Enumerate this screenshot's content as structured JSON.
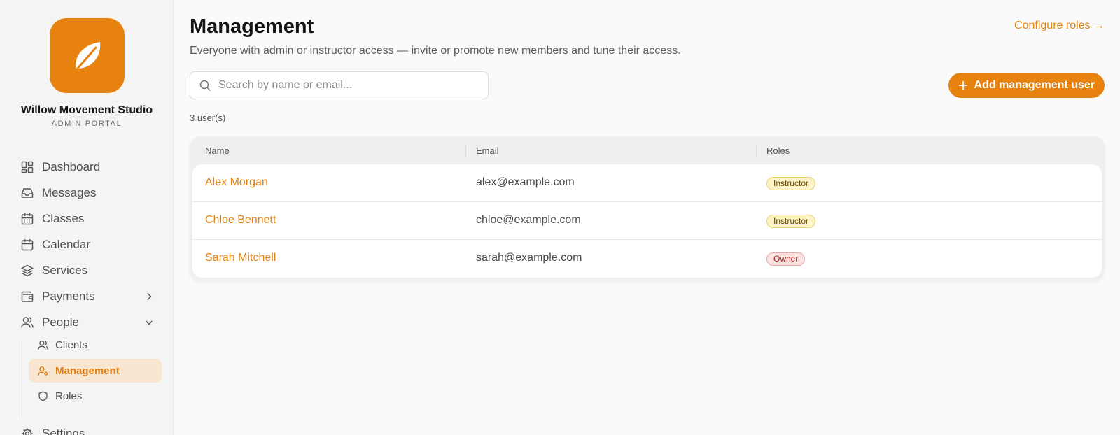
{
  "brand": {
    "name": "Willow Movement Studio",
    "subtitle": "ADMIN PORTAL",
    "color": "#e8820f",
    "logo_icon": "leaf-icon"
  },
  "sidebar": {
    "items": [
      {
        "label": "Dashboard",
        "icon": "dashboard-icon"
      },
      {
        "label": "Messages",
        "icon": "inbox-icon"
      },
      {
        "label": "Classes",
        "icon": "calendar-grid-icon"
      },
      {
        "label": "Calendar",
        "icon": "calendar-icon"
      },
      {
        "label": "Services",
        "icon": "layers-icon"
      },
      {
        "label": "Payments",
        "icon": "wallet-icon",
        "expanded": false
      },
      {
        "label": "People",
        "icon": "users-icon",
        "expanded": true
      },
      {
        "label": "Settings",
        "icon": "gear-icon"
      }
    ],
    "people_sub": [
      {
        "label": "Clients",
        "icon": "users-icon",
        "active": false
      },
      {
        "label": "Management",
        "icon": "user-cog-icon",
        "active": true
      },
      {
        "label": "Roles",
        "icon": "shield-icon",
        "active": false
      }
    ]
  },
  "header": {
    "title": "Management",
    "subtitle": "Everyone with admin or instructor access — invite or promote new members and tune their access.",
    "configure_link": "Configure roles →"
  },
  "search": {
    "placeholder": "Search by name or email...",
    "value": ""
  },
  "add_button": {
    "label": "Add management user",
    "icon": "plus-icon"
  },
  "user_count": "3 user(s)",
  "table": {
    "columns": [
      "Name",
      "Email",
      "Roles"
    ],
    "rows": [
      {
        "name": "Alex Morgan",
        "email": "alex@example.com",
        "role": "Instructor",
        "role_type": "instructor"
      },
      {
        "name": "Chloe Bennett",
        "email": "chloe@example.com",
        "role": "Instructor",
        "role_type": "instructor"
      },
      {
        "name": "Sarah Mitchell",
        "email": "sarah@example.com",
        "role": "Owner",
        "role_type": "owner"
      }
    ]
  }
}
